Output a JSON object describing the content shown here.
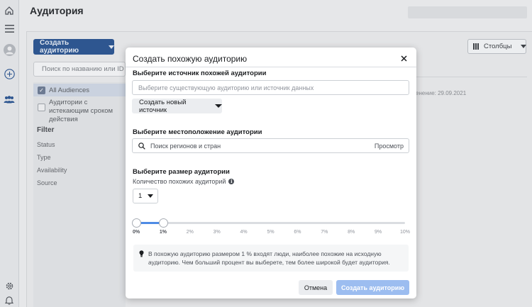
{
  "page": {
    "title": "Аудитория",
    "create_audience_label": "Создать аудиторию",
    "search_placeholder": "Поиск по названию или ID а",
    "audience_filters": [
      {
        "label": "All Audiences",
        "checked": true
      },
      {
        "label": "Аудитории с истекающим сроком действия",
        "checked": false
      }
    ],
    "filter_title": "Filter",
    "filter_items": [
      "Status",
      "Type",
      "Availability",
      "Source"
    ],
    "columns_label": "Столбцы",
    "date_fragment": "енение: 29.09.2021"
  },
  "modal": {
    "title": "Создать похожую аудиторию",
    "source_section_label": "Выберите источник похожей аудитории",
    "source_placeholder": "Выберите существующую аудиторию или источник данных",
    "new_source_label": "Создать новый источник",
    "location_section_label": "Выберите местоположение аудитории",
    "location_placeholder": "Поиск регионов и стран",
    "location_browse_label": "Просмотр",
    "size_section_label": "Выберите размер аудитории",
    "count_label": "Количество похожих аудиторий",
    "count_value": "1",
    "slider": {
      "ticks": [
        "0%",
        "1%",
        "2%",
        "3%",
        "4%",
        "5%",
        "6%",
        "7%",
        "8%",
        "9%",
        "10%"
      ],
      "range_start_percent": 0,
      "range_end_percent": 1,
      "max_percent": 10
    },
    "note_text": "В похожую аудиторию размером 1 % входят люди, наиболее похожие на исходную аудиторию. Чем больший процент вы выберете, тем более широкой будет аудитория.",
    "cancel_label": "Отмена",
    "confirm_label": "Создать аудиторию"
  },
  "colors": {
    "primary": "#1877f2",
    "slider_fill": "#4f8be5",
    "confirm_disabled": "#9cbdf0"
  }
}
